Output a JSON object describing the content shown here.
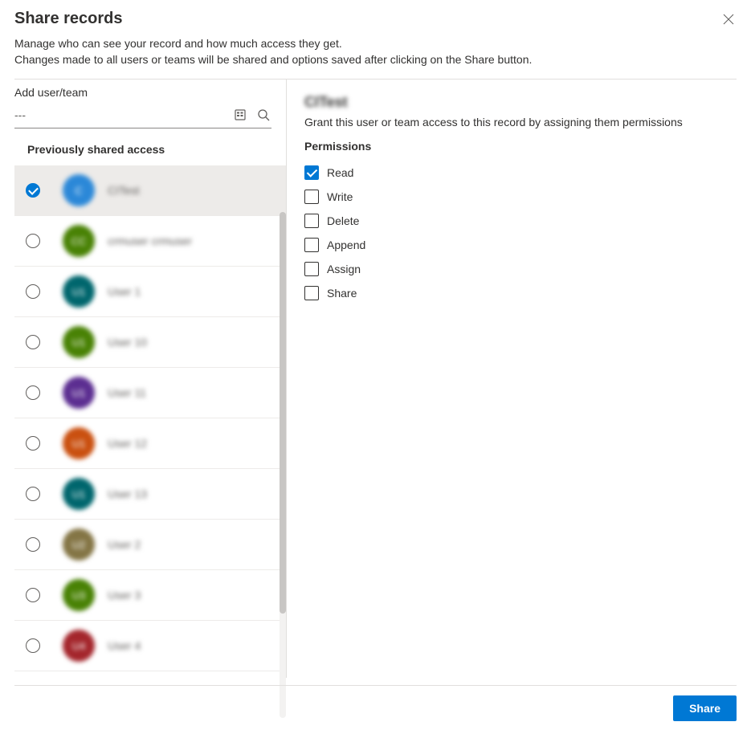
{
  "header": {
    "title": "Share records",
    "subtitle_line1": "Manage who can see your record and how much access they get.",
    "subtitle_line2": "Changes made to all users or teams will be shared and options saved after clicking on the Share button."
  },
  "left": {
    "add_label": "Add user/team",
    "search_value": "---",
    "prev_shared_label": "Previously shared access",
    "items": [
      {
        "name": "CITest",
        "initials": "C",
        "color": "#2b88d8",
        "selected": true
      },
      {
        "name": "crmuser crmuser",
        "initials": "CC",
        "color": "#498205",
        "selected": false
      },
      {
        "name": "User 1",
        "initials": "U1",
        "color": "#00666d",
        "selected": false
      },
      {
        "name": "User 10",
        "initials": "U1",
        "color": "#498205",
        "selected": false
      },
      {
        "name": "User 11",
        "initials": "U1",
        "color": "#5c2e91",
        "selected": false
      },
      {
        "name": "User 12",
        "initials": "U1",
        "color": "#ca5010",
        "selected": false
      },
      {
        "name": "User 13",
        "initials": "U1",
        "color": "#00666d",
        "selected": false
      },
      {
        "name": "User 2",
        "initials": "U2",
        "color": "#847545",
        "selected": false
      },
      {
        "name": "User 3",
        "initials": "U3",
        "color": "#498205",
        "selected": false
      },
      {
        "name": "User 4",
        "initials": "U4",
        "color": "#a4262c",
        "selected": false
      }
    ]
  },
  "right": {
    "selected_name": "CITest",
    "description": "Grant this user or team access to this record by assigning them permissions",
    "permissions_heading": "Permissions",
    "permissions": [
      {
        "label": "Read",
        "checked": true
      },
      {
        "label": "Write",
        "checked": false
      },
      {
        "label": "Delete",
        "checked": false
      },
      {
        "label": "Append",
        "checked": false
      },
      {
        "label": "Assign",
        "checked": false
      },
      {
        "label": "Share",
        "checked": false
      }
    ]
  },
  "footer": {
    "share_label": "Share"
  }
}
